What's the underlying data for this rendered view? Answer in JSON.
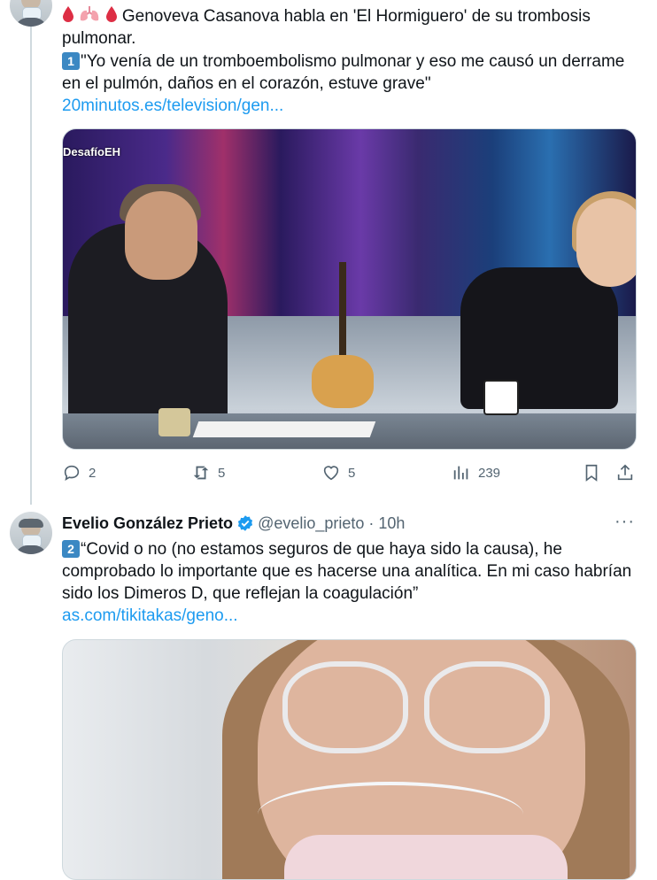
{
  "tweet1": {
    "line1": "Genoveva Casanova habla en 'El Hormiguero' de su trombosis",
    "line2": "pulmonar.",
    "num_badge": "1",
    "quote_line1": "\"Yo venía de un tromboembolismo pulmonar y eso me causó un derrame",
    "quote_line2": "en el pulmón, daños en el corazón, estuve grave\"",
    "link": "20minutos.es/television/gen...",
    "media_watermark": "DesafíoEH",
    "replies": "2",
    "retweets": "5",
    "likes": "5",
    "views": "239"
  },
  "tweet2": {
    "display_name": "Evelio González Prieto",
    "handle": "@evelio_prieto",
    "separator": "·",
    "time": "10h",
    "more": "···",
    "num_badge": "2",
    "line1": "“Covid o no (no estamos seguros de que haya sido la causa), he",
    "line2": "comprobado lo importante que es hacerse una analítica. En mi caso habrían",
    "line3": "sido los Dimeros D, que reflejan la coagulación”",
    "link": "as.com/tikitakas/geno..."
  },
  "colors": {
    "link": "#1d9bf0",
    "muted": "#536471",
    "verified": "#1d9bf0"
  }
}
